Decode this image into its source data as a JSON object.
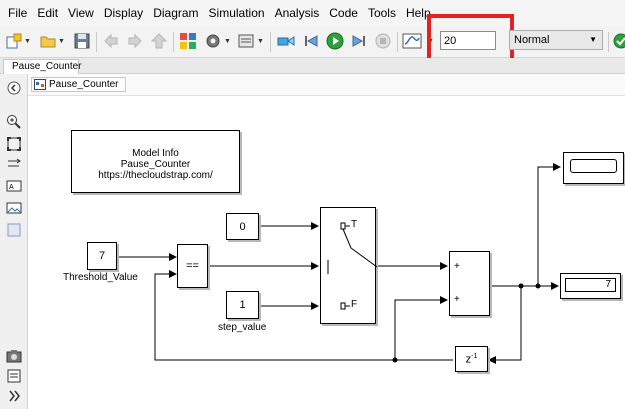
{
  "menu": [
    "File",
    "Edit",
    "View",
    "Display",
    "Diagram",
    "Simulation",
    "Analysis",
    "Code",
    "Tools",
    "Help"
  ],
  "toolbar": {
    "stop_time": "20",
    "sim_mode": "Normal",
    "icons": [
      "new-model-icon",
      "open-icon",
      "save-icon",
      "back-icon",
      "forward-icon",
      "up-icon",
      "library-browser-icon",
      "model-settings-icon",
      "model-explorer-icon",
      "step-back-icon",
      "run-icon",
      "step-forward-icon",
      "stop-icon",
      "scope-icon",
      "check-icon"
    ]
  },
  "tab": {
    "label": "Pause_Counter"
  },
  "breadcrumb": {
    "label": "Pause_Counter"
  },
  "model": {
    "info_title": "Model Info",
    "info_name": "Pause_Counter",
    "info_url": "https://thecloudstrap.com/",
    "threshold_value": "7",
    "threshold_label": "Threshold_Value",
    "relop": "==",
    "const_zero": "0",
    "const_step": "1",
    "step_label": "step_value",
    "switch_true": "T",
    "switch_false": "F",
    "sum_plus_1": "+",
    "sum_plus_2": "+",
    "display_value": "7",
    "delay_label": "z",
    "delay_exp": "-1"
  }
}
